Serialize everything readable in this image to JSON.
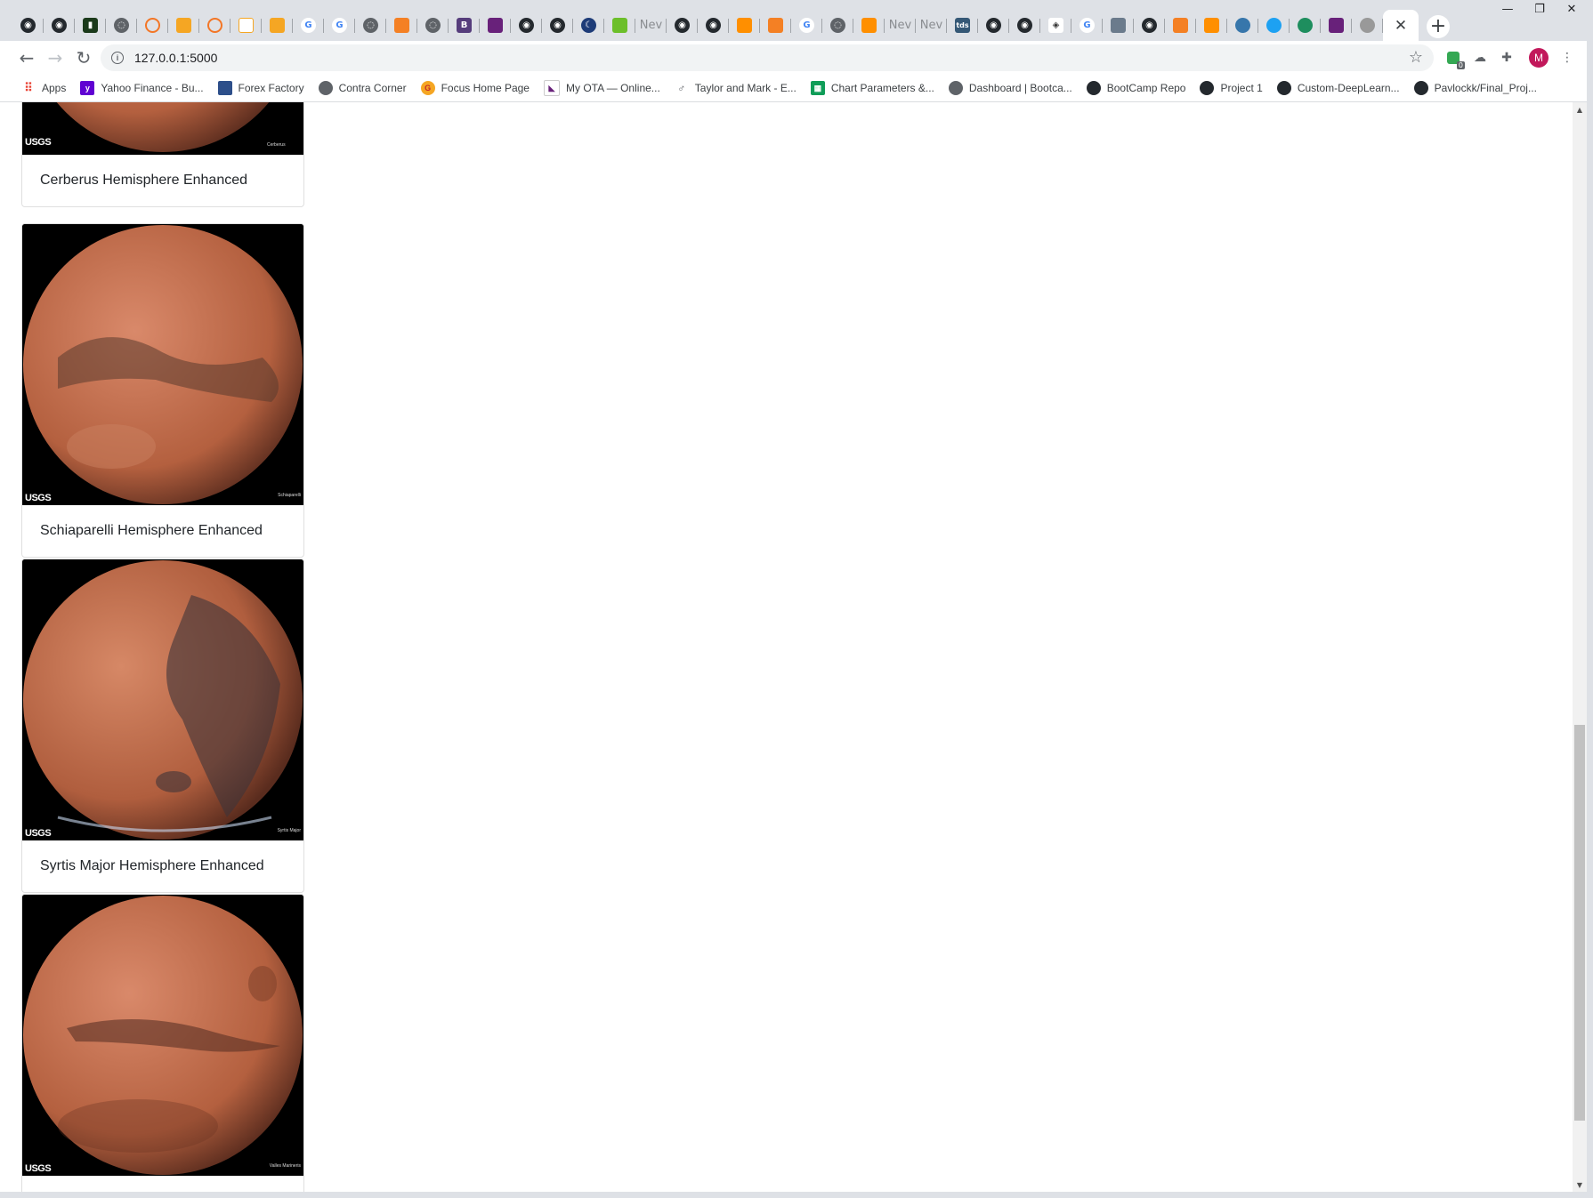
{
  "browser": {
    "url": "127.0.0.1:5000",
    "new_tab_label": "+",
    "close_tab_label": "✕",
    "avatar_letter": "M",
    "tab_text_fragment": "Nev",
    "tab_tds_label": "tds",
    "tab_b_label": "B",
    "tab_g_label": "G",
    "ext_badge": "0"
  },
  "bookmarks": [
    {
      "label": "Apps",
      "icon": "apps-grid-icon"
    },
    {
      "label": "Yahoo Finance - Bu...",
      "icon": "yahoo-icon"
    },
    {
      "label": "Forex Factory",
      "icon": "forex-factory-icon"
    },
    {
      "label": "Contra Corner",
      "icon": "globe-icon"
    },
    {
      "label": "Focus Home Page",
      "icon": "focus-icon"
    },
    {
      "label": "My OTA — Online...",
      "icon": "ota-icon"
    },
    {
      "label": "Taylor and Mark - E...",
      "icon": "male-symbol-icon"
    },
    {
      "label": "Chart Parameters &...",
      "icon": "sheets-icon"
    },
    {
      "label": "Dashboard | Bootca...",
      "icon": "globe-icon"
    },
    {
      "label": "BootCamp Repo",
      "icon": "github-icon"
    },
    {
      "label": "Project 1",
      "icon": "github-icon"
    },
    {
      "label": "Custom-DeepLearn...",
      "icon": "github-icon"
    },
    {
      "label": "Pavlockk/Final_Proj...",
      "icon": "github-icon"
    }
  ],
  "hemispheres": [
    {
      "title": "Cerberus Hemisphere Enhanced",
      "image_label": "Cerberus",
      "logo": "USGS"
    },
    {
      "title": "Schiaparelli Hemisphere Enhanced",
      "image_label": "Schiaparelli",
      "logo": "USGS"
    },
    {
      "title": "Syrtis Major Hemisphere Enhanced",
      "image_label": "Syrtis Major",
      "logo": "USGS"
    },
    {
      "title": "",
      "image_label": "Valles Marineris",
      "logo": "USGS"
    }
  ],
  "colors": {
    "mars_light": "#d9896a",
    "mars_mid": "#b4603f",
    "mars_dark": "#5a2c1e"
  }
}
